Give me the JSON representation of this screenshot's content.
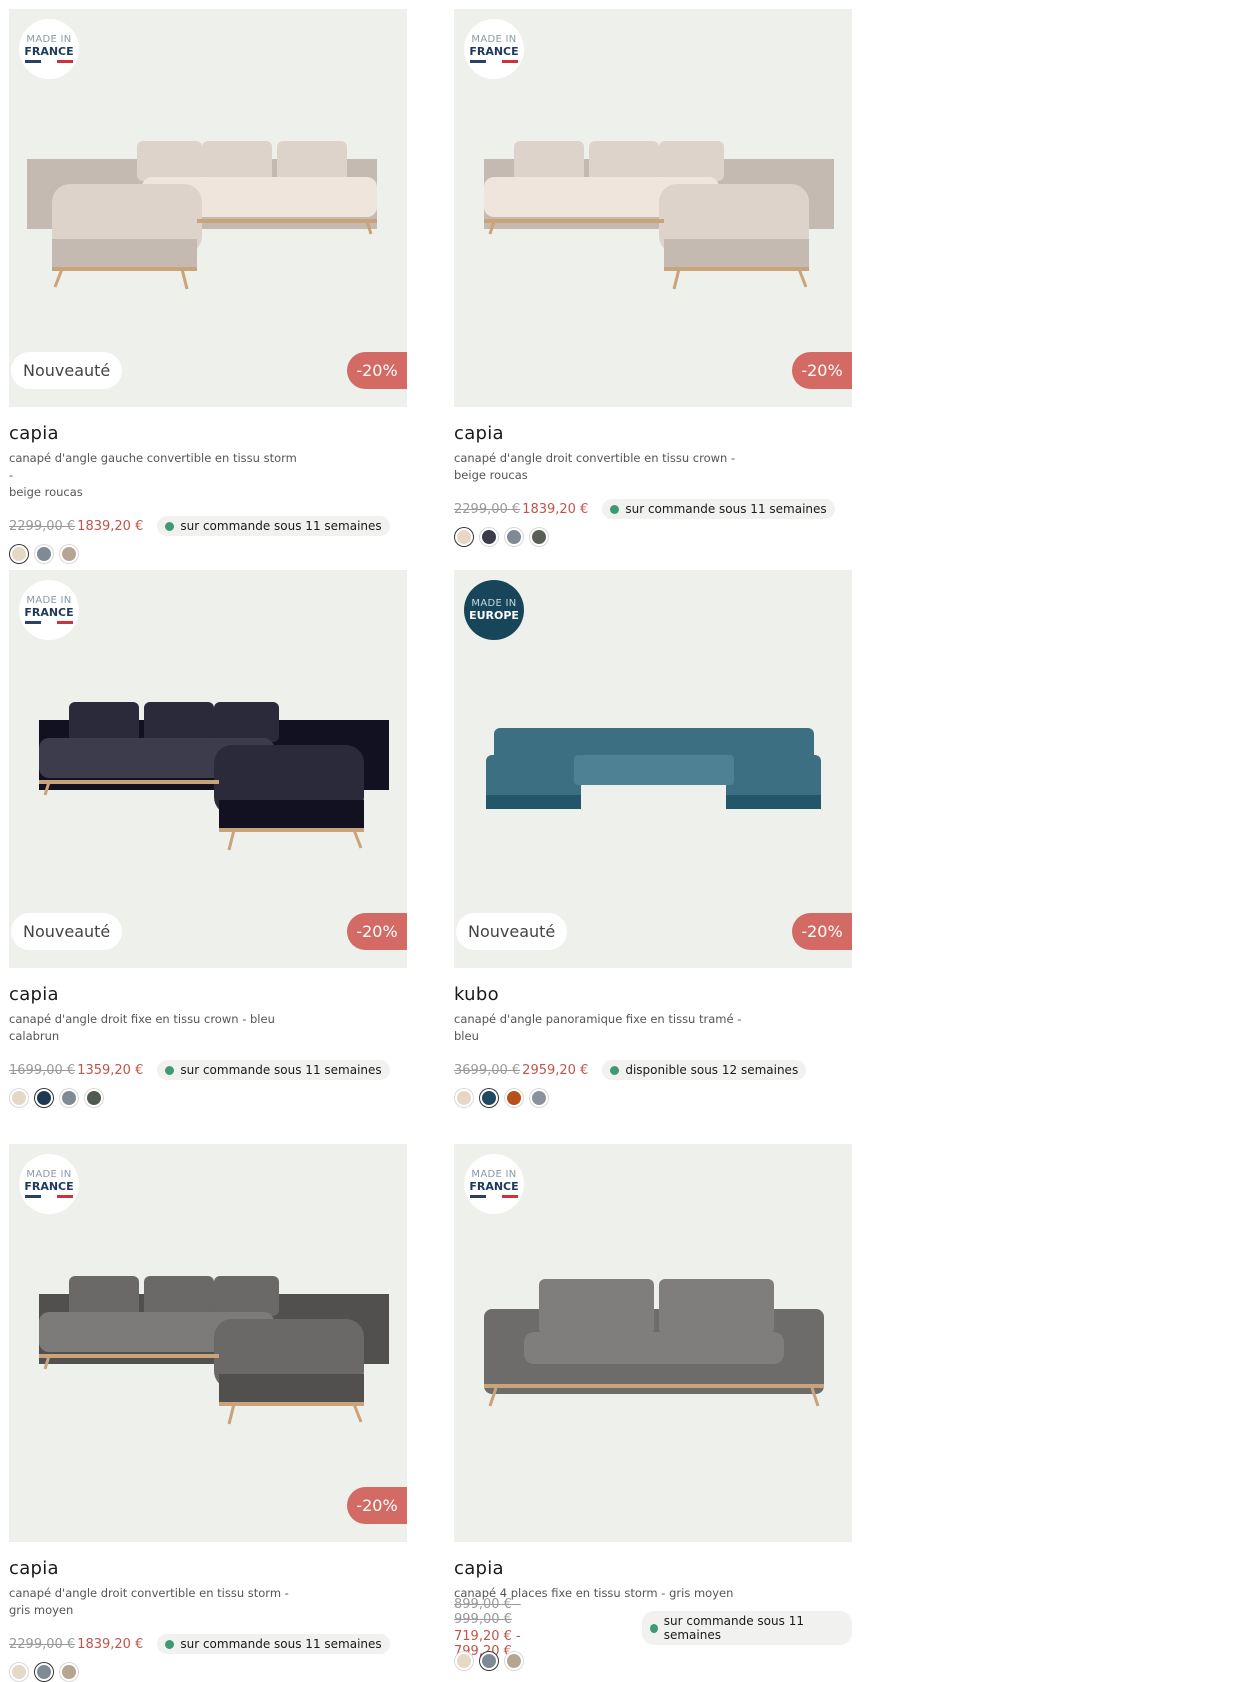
{
  "products": [
    {
      "made_in": {
        "line1": "MADE IN",
        "line2": "FRANCE",
        "style": "france"
      },
      "badge_new": "Nouveauté",
      "discount": "-20%",
      "title": "capia",
      "desc_line1": "canapé d'angle gauche convertible en tissu storm -",
      "desc_line2": "beige roucas",
      "old_price": "2299,00 €",
      "new_price": "1839,20 €",
      "availability": "sur commande sous 11 semaines",
      "swatches": [
        "#e5d9c6",
        "#7f8a94",
        "#b6a592"
      ],
      "selected_swatch": 0,
      "sofa_color": "#ddd3cb",
      "sofa_shape": "angle-left"
    },
    {
      "made_in": {
        "line1": "MADE IN",
        "line2": "FRANCE",
        "style": "france"
      },
      "badge_new": "",
      "discount": "-20%",
      "title": "capia",
      "desc_line1": "canapé d'angle droit convertible en tissu crown -",
      "desc_line2": "beige roucas",
      "old_price": "2299,00 €",
      "new_price": "1839,20 €",
      "availability": "sur commande sous 11 semaines",
      "swatches": [
        "#e5d9c6",
        "#3a3c4a",
        "#7f8a94",
        "#5a6058"
      ],
      "selected_swatch": 0,
      "sofa_color": "#ddd3cb",
      "sofa_shape": "angle-right"
    },
    {
      "made_in": {
        "line1": "MADE IN",
        "line2": "FRANCE",
        "style": "france"
      },
      "badge_new": "Nouveauté",
      "discount": "-20%",
      "title": "capia",
      "desc_line1": "canapé d'angle droit fixe en tissu crown - bleu",
      "desc_line2": "calabrun",
      "old_price": "1699,00 €",
      "new_price": "1359,20 €",
      "availability": "sur commande sous 11 semaines",
      "swatches": [
        "#e5d9c6",
        "#1d3a52",
        "#7f8a94",
        "#4f5a50"
      ],
      "selected_swatch": 1,
      "sofa_color": "#2a2a3b",
      "sofa_shape": "angle-right"
    },
    {
      "made_in": {
        "line1": "MADE IN",
        "line2": "EUROPE",
        "style": "europe"
      },
      "badge_new": "Nouveauté",
      "discount": "-20%",
      "title": "kubo",
      "desc_line1": "canapé d'angle panoramique fixe en tissu tramé -",
      "desc_line2": "bleu",
      "old_price": "3699,00 €",
      "new_price": "2959,20 €",
      "availability": "disponible sous 12 semaines",
      "swatches": [
        "#e5d9c6",
        "#1d4a60",
        "#b8501c",
        "#8a939c"
      ],
      "selected_swatch": 1,
      "sofa_color": "#3c6f82",
      "sofa_shape": "panoramic"
    },
    {
      "made_in": {
        "line1": "MADE IN",
        "line2": "FRANCE",
        "style": "france"
      },
      "badge_new": "",
      "discount": "-20%",
      "title": "capia",
      "desc_line1": "canapé d'angle droit convertible en tissu storm -",
      "desc_line2": "gris moyen",
      "old_price": "2299,00 €",
      "new_price": "1839,20 €",
      "availability": "sur commande sous 11 semaines",
      "swatches": [
        "#e5d9c6",
        "#7f8a94",
        "#b6a592"
      ],
      "selected_swatch": 1,
      "sofa_color": "#6a6968",
      "sofa_shape": "angle-right"
    },
    {
      "made_in": {
        "line1": "MADE IN",
        "line2": "FRANCE",
        "style": "france"
      },
      "badge_new": "",
      "discount": "",
      "title": "capia",
      "desc_line1": "canapé 4 places fixe en tissu storm - gris moyen",
      "desc_line2": "",
      "old_price": "899,00 € - 999,00 €",
      "new_price": "719,20 € - 799,20 €",
      "availability": "sur commande sous 11 semaines",
      "swatches": [
        "#e5d9c6",
        "#7f8a94",
        "#b6a592"
      ],
      "selected_swatch": 1,
      "sofa_color": "#6d6c6b",
      "sofa_shape": "straight"
    }
  ]
}
